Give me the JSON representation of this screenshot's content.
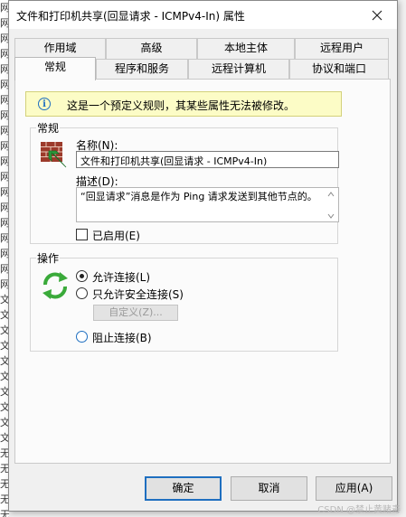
{
  "background": {
    "left_column_chars": [
      "网",
      "网",
      "网",
      "网",
      "网",
      "网",
      "网",
      "网",
      "网",
      "网",
      "网",
      "网",
      "网",
      "网",
      "网",
      "网",
      "网",
      "网",
      "网",
      "文",
      "文",
      "文",
      "文",
      "文",
      "文",
      "文",
      "文",
      "文",
      "文",
      "无",
      "无",
      "无",
      "无",
      "无"
    ]
  },
  "window": {
    "title": "文件和打印机共享(回显请求 - ICMPv4-In) 属性",
    "close_glyph": "✕"
  },
  "tabs": {
    "row_top": [
      "作用域",
      "高级",
      "本地主体",
      "远程用户"
    ],
    "row_bottom": [
      "常规",
      "程序和服务",
      "远程计算机",
      "协议和端口"
    ]
  },
  "info_bar": {
    "icon_glyph": "i",
    "text": "这是一个预定义规则，其某些属性无法被修改。"
  },
  "general": {
    "group_label": "常规",
    "name_label": "名称(N):",
    "name_value": "文件和打印机共享(回显请求 - ICMPv4-In)",
    "desc_label": "描述(D):",
    "desc_value": "“回显请求”消息是作为 Ping 请求发送到其他节点的。",
    "enabled_label": "已启用(E)",
    "enabled_checked": false
  },
  "action": {
    "group_label": "操作",
    "allow_label": "允许连接(L)",
    "allow_secure_label": "只允许安全连接(S)",
    "customize_label": "自定义(Z)...",
    "block_label": "阻止连接(B)",
    "selected": "allow"
  },
  "footer": {
    "ok_label": "确定",
    "cancel_label": "取消",
    "apply_label": "应用(A)"
  },
  "watermark": "CSDN @禁止黄赌毒",
  "colors": {
    "accent": "#1f6fc0",
    "info_bg": "#fcfcc6"
  }
}
